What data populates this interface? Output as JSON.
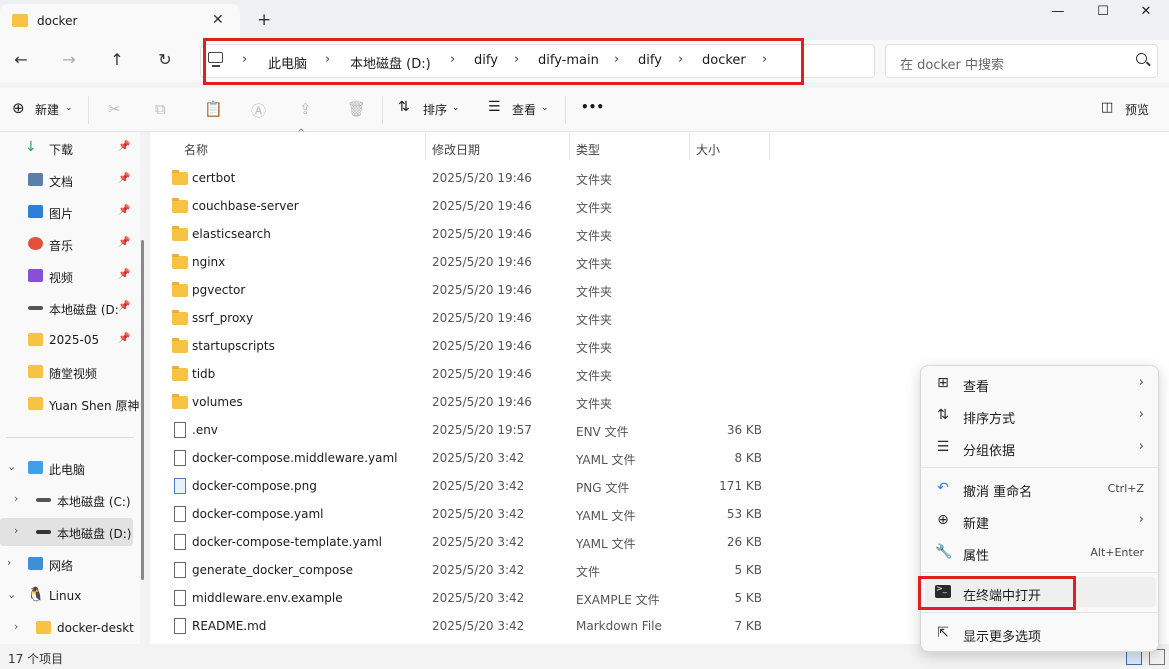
{
  "window": {
    "tab_title": "docker",
    "new_tab_symbol": "+",
    "close_symbol": "✕",
    "minimize_symbol": "—",
    "maximize_symbol": "☐",
    "close_window_symbol": "✕"
  },
  "nav": {
    "breadcrumbs": [
      "此电脑",
      "本地磁盘 (D:)",
      "dify",
      "dify-main",
      "dify",
      "docker"
    ],
    "search_placeholder": "在 docker 中搜索"
  },
  "commands": {
    "new_label": "新建",
    "sort_label": "排序",
    "view_label": "查看",
    "more_label": "•••",
    "preview_label": "预览"
  },
  "sidebar": {
    "quick_access": [
      {
        "label": "下载",
        "pinned": true,
        "icon": "download-icon",
        "color": "#2e9e4f"
      },
      {
        "label": "文档",
        "pinned": true,
        "icon": "document-icon",
        "color": "#5b7fa8"
      },
      {
        "label": "图片",
        "pinned": true,
        "icon": "picture-icon",
        "color": "#2f7fd6"
      },
      {
        "label": "音乐",
        "pinned": true,
        "icon": "music-icon",
        "color": "#e2523b"
      },
      {
        "label": "视频",
        "pinned": true,
        "icon": "video-icon",
        "color": "#8a4fd6"
      },
      {
        "label": "本地磁盘 (D:",
        "pinned": true,
        "icon": "drive-icon",
        "color": "#555555"
      },
      {
        "label": "2025-05",
        "pinned": true,
        "icon": "folder-icon",
        "color": "#f6c342"
      },
      {
        "label": "随堂视频",
        "pinned": false,
        "icon": "folder-icon",
        "color": "#f6c342"
      },
      {
        "label": "Yuan Shen 原神",
        "pinned": false,
        "icon": "folder-icon",
        "color": "#f6c342"
      }
    ],
    "tree": [
      {
        "label": "此电脑",
        "expanded": true,
        "icon": "computer-icon"
      },
      {
        "label": "本地磁盘 (C:)",
        "expanded": false,
        "icon": "drive-icon"
      },
      {
        "label": "本地磁盘 (D:)",
        "expanded": false,
        "icon": "drive-icon",
        "selected": true
      },
      {
        "label": "网络",
        "expanded": false,
        "icon": "network-icon"
      },
      {
        "label": "Linux",
        "expanded": true,
        "icon": "linux-icon"
      },
      {
        "label": "docker-deskt",
        "expanded": false,
        "icon": "folder-icon"
      }
    ]
  },
  "filelist": {
    "columns": [
      "名称",
      "修改日期",
      "类型",
      "大小"
    ],
    "rows": [
      {
        "name": "certbot",
        "date": "2025/5/20 19:46",
        "type": "文件夹",
        "size": "",
        "kind": "folder"
      },
      {
        "name": "couchbase-server",
        "date": "2025/5/20 19:46",
        "type": "文件夹",
        "size": "",
        "kind": "folder"
      },
      {
        "name": "elasticsearch",
        "date": "2025/5/20 19:46",
        "type": "文件夹",
        "size": "",
        "kind": "folder"
      },
      {
        "name": "nginx",
        "date": "2025/5/20 19:46",
        "type": "文件夹",
        "size": "",
        "kind": "folder"
      },
      {
        "name": "pgvector",
        "date": "2025/5/20 19:46",
        "type": "文件夹",
        "size": "",
        "kind": "folder"
      },
      {
        "name": "ssrf_proxy",
        "date": "2025/5/20 19:46",
        "type": "文件夹",
        "size": "",
        "kind": "folder"
      },
      {
        "name": "startupscripts",
        "date": "2025/5/20 19:46",
        "type": "文件夹",
        "size": "",
        "kind": "folder"
      },
      {
        "name": "tidb",
        "date": "2025/5/20 19:46",
        "type": "文件夹",
        "size": "",
        "kind": "folder"
      },
      {
        "name": "volumes",
        "date": "2025/5/20 19:46",
        "type": "文件夹",
        "size": "",
        "kind": "folder"
      },
      {
        "name": ".env",
        "date": "2025/5/20 19:57",
        "type": "ENV 文件",
        "size": "36 KB",
        "kind": "file"
      },
      {
        "name": "docker-compose.middleware.yaml",
        "date": "2025/5/20 3:42",
        "type": "YAML 文件",
        "size": "8 KB",
        "kind": "file"
      },
      {
        "name": "docker-compose.png",
        "date": "2025/5/20 3:42",
        "type": "PNG 文件",
        "size": "171 KB",
        "kind": "png"
      },
      {
        "name": "docker-compose.yaml",
        "date": "2025/5/20 3:42",
        "type": "YAML 文件",
        "size": "53 KB",
        "kind": "file"
      },
      {
        "name": "docker-compose-template.yaml",
        "date": "2025/5/20 3:42",
        "type": "YAML 文件",
        "size": "26 KB",
        "kind": "file"
      },
      {
        "name": "generate_docker_compose",
        "date": "2025/5/20 3:42",
        "type": "文件",
        "size": "5 KB",
        "kind": "file"
      },
      {
        "name": "middleware.env.example",
        "date": "2025/5/20 3:42",
        "type": "EXAMPLE 文件",
        "size": "5 KB",
        "kind": "file"
      },
      {
        "name": "README.md",
        "date": "2025/5/20 3:42",
        "type": "Markdown File",
        "size": "7 KB",
        "kind": "file"
      }
    ]
  },
  "status": {
    "count_text": "17 个项目"
  },
  "context_menu": {
    "items": [
      {
        "label": "查看",
        "icon": "grid-icon",
        "glyph": "⊞",
        "shortcut": "",
        "submenu": true
      },
      {
        "label": "排序方式",
        "icon": "sort-icon",
        "glyph": "⇅",
        "shortcut": "",
        "submenu": true
      },
      {
        "label": "分组依据",
        "icon": "group-icon",
        "glyph": "☰",
        "shortcut": "",
        "submenu": true
      },
      {
        "label": "撤消 重命名",
        "icon": "undo-icon",
        "glyph": "↶",
        "shortcut": "Ctrl+Z",
        "submenu": false
      },
      {
        "label": "新建",
        "icon": "add-icon",
        "glyph": "⊕",
        "shortcut": "",
        "submenu": true
      },
      {
        "label": "属性",
        "icon": "wrench-icon",
        "glyph": "🔧",
        "shortcut": "Alt+Enter",
        "submenu": false
      },
      {
        "label": "在终端中打开",
        "icon": "terminal-icon",
        "glyph": "",
        "shortcut": "",
        "submenu": false
      },
      {
        "label": "显示更多选项",
        "icon": "open-external-icon",
        "glyph": "⇱",
        "shortcut": "",
        "submenu": false
      }
    ]
  },
  "colors": {
    "highlight_box": "#e02020",
    "folder": "#f6c342",
    "selection": "#e2e2e2"
  }
}
